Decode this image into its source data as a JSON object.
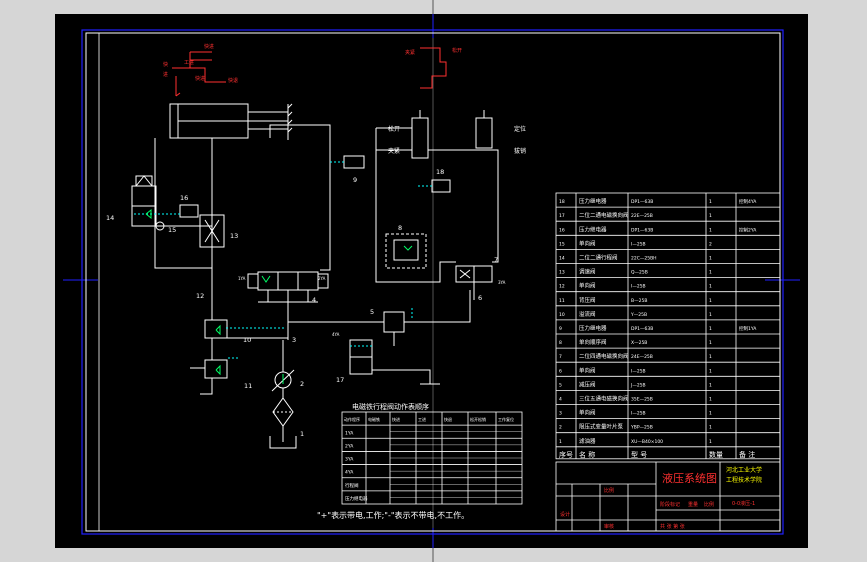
{
  "colors": {
    "background": "#000000",
    "chrome": "#d6d6d6",
    "line": "#ffffff",
    "frame": "#2020ff",
    "red": "#ff3030",
    "green": "#00ff66",
    "cyan": "#00ffff",
    "yellow": "#ffff00"
  },
  "annotations": {
    "top_left": {
      "left_chars": [
        "快",
        "进"
      ],
      "top": "快进",
      "middle": "工进",
      "bottom": "快退",
      "extra": "快进"
    },
    "top_right": {
      "left": "夹紧",
      "right": "松开"
    }
  },
  "labels": {
    "clamp_release": "松开",
    "clamp_tight": "夹紧",
    "locate": "定位",
    "loosen": "拔销",
    "n1": "1",
    "n2": "2",
    "n3": "3",
    "n4": "4",
    "n5": "5",
    "n6": "6",
    "n7": "7",
    "n8": "8",
    "n9": "9",
    "n10": "10",
    "n11": "11",
    "n12": "12",
    "n13": "13",
    "n14": "14",
    "n15": "15",
    "n16": "16",
    "n17": "17",
    "n18": "18",
    "sol_1ya": "1YA",
    "sol_2ya": "2YA",
    "sol_3ya": "3YA",
    "sol_4ya": "4YA"
  },
  "sequence_table": {
    "title": "电磁铁行程阀动作表顺序",
    "headers": [
      "动作程序",
      "电磁铁",
      "快进",
      "工进",
      "快退",
      "松开松销",
      "工作复位"
    ],
    "rows": [
      "1YA",
      "2YA",
      "3YA",
      "4YA",
      "行程阀",
      "压力继电器"
    ],
    "note": "\"+\"表示带电,工作;\"-\"表示不带电,不工作。"
  },
  "parts_list": {
    "rows": [
      {
        "no": "18",
        "name": "压力继电器",
        "spec": "DP1—63B",
        "qty": "1",
        "remark": "控制4YA"
      },
      {
        "no": "17",
        "name": "二位二通电磁换向阀",
        "spec": "22E—25B",
        "qty": "1",
        "remark": ""
      },
      {
        "no": "16",
        "name": "压力继电器",
        "spec": "DP1—63B",
        "qty": "1",
        "remark": "控制2YA"
      },
      {
        "no": "15",
        "name": "单向阀",
        "spec": "I—25B",
        "qty": "2",
        "remark": ""
      },
      {
        "no": "14",
        "name": "二位二通行程阀",
        "spec": "22C—25BH",
        "qty": "1",
        "remark": ""
      },
      {
        "no": "13",
        "name": "调速阀",
        "spec": "Q—25B",
        "qty": "1",
        "remark": ""
      },
      {
        "no": "12",
        "name": "单向阀",
        "spec": "I—25B",
        "qty": "1",
        "remark": ""
      },
      {
        "no": "11",
        "name": "背压阀",
        "spec": "B—25B",
        "qty": "1",
        "remark": ""
      },
      {
        "no": "10",
        "name": "溢流阀",
        "spec": "Y—25B",
        "qty": "1",
        "remark": ""
      },
      {
        "no": "9",
        "name": "压力继电器",
        "spec": "DP1—63B",
        "qty": "1",
        "remark": "控制1YA"
      },
      {
        "no": "8",
        "name": "单向顺序阀",
        "spec": "X—25B",
        "qty": "1",
        "remark": ""
      },
      {
        "no": "7",
        "name": "二位四通电磁换向阀",
        "spec": "24E—25B",
        "qty": "1",
        "remark": ""
      },
      {
        "no": "6",
        "name": "单向阀",
        "spec": "I—25B",
        "qty": "1",
        "remark": ""
      },
      {
        "no": "5",
        "name": "减压阀",
        "spec": "J—25B",
        "qty": "1",
        "remark": ""
      },
      {
        "no": "4",
        "name": "三位五通电磁换向阀",
        "spec": "35E—25B",
        "qty": "1",
        "remark": ""
      },
      {
        "no": "3",
        "name": "单向阀",
        "spec": "I—25B",
        "qty": "1",
        "remark": ""
      },
      {
        "no": "2",
        "name": "限压式变量叶片泵",
        "spec": "YBP—25B",
        "qty": "1",
        "remark": ""
      },
      {
        "no": "1",
        "name": "滤油器",
        "spec": "XU—B40×100",
        "qty": "1",
        "remark": ""
      }
    ],
    "header": {
      "no": "序号",
      "name": "名 称",
      "spec": "型  号",
      "qty": "数量",
      "remark": "备 注"
    }
  },
  "title_block": {
    "drawing_title": "液压系统图",
    "school_line1": "河北工业大学",
    "school_line2": "工程技术学院",
    "drawing_no": "0-0液压-1",
    "designer": "设计",
    "checker": "审核",
    "scale_label": "比例",
    "sheet_label": "共 张 第 张",
    "stage_label": "阶段标记",
    "weight_label": "重量",
    "ratio_label": "比例"
  }
}
